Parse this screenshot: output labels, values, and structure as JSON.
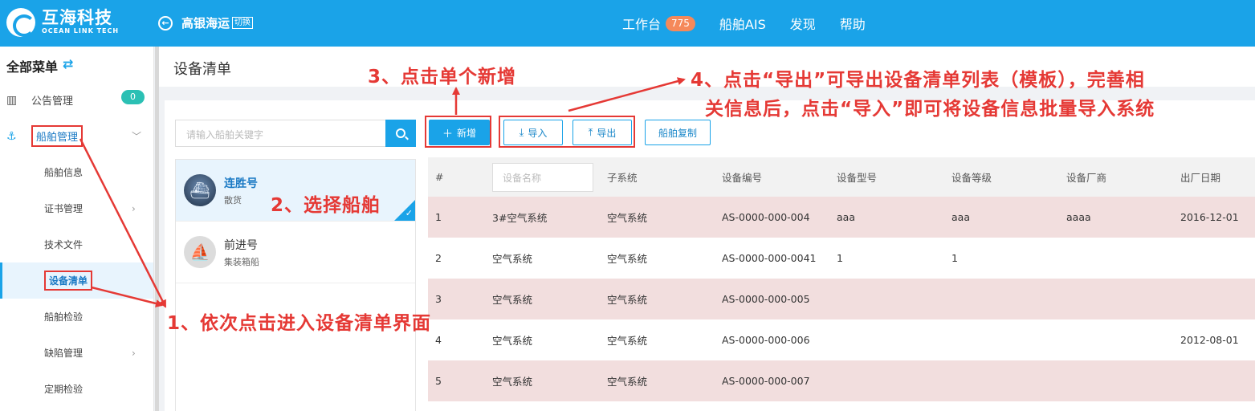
{
  "brand": {
    "name_cn": "互海科技",
    "name_en": "OCEAN LINK TECH"
  },
  "company": {
    "name": "高银海运",
    "switch_label": "切换"
  },
  "topnav": [
    {
      "label": "工作台",
      "badge": "775"
    },
    {
      "label": "船舶AIS"
    },
    {
      "label": "发现"
    },
    {
      "label": "帮助"
    }
  ],
  "sidebar": {
    "header": "全部菜单",
    "items": [
      {
        "label": "公告管理",
        "badge": "0"
      },
      {
        "label": "船舶管理"
      }
    ],
    "submenu": [
      "船舶信息",
      "证书管理",
      "技术文件",
      "设备清单",
      "船舶检验",
      "缺陷管理",
      "定期检验"
    ]
  },
  "page": {
    "title": "设备清单"
  },
  "search": {
    "placeholder": "请输入船舶关键字"
  },
  "ships": [
    {
      "name": "连胜号",
      "type": "散货"
    },
    {
      "name": "前进号",
      "type": "集装箱船"
    }
  ],
  "toolbar": {
    "add": "新增",
    "import": "导入",
    "export": "导出",
    "copy": "船舶复制"
  },
  "table": {
    "columns": [
      "#",
      "设备名称",
      "子系统",
      "设备编号",
      "设备型号",
      "设备等级",
      "设备厂商",
      "出厂日期"
    ],
    "filter_placeholder": "设备名称",
    "rows": [
      [
        "1",
        "3#空气系统",
        "空气系统",
        "AS-0000-000-004",
        "aaa",
        "aaa",
        "aaaa",
        "2016-12-01"
      ],
      [
        "2",
        "空气系统",
        "空气系统",
        "AS-0000-000-0041",
        "1",
        "1",
        "",
        ""
      ],
      [
        "3",
        "空气系统",
        "空气系统",
        "AS-0000-000-005",
        "",
        "",
        "",
        ""
      ],
      [
        "4",
        "空气系统",
        "空气系统",
        "AS-0000-000-006",
        "",
        "",
        "",
        "2012-08-01"
      ],
      [
        "5",
        "空气系统",
        "空气系统",
        "AS-0000-000-007",
        "",
        "",
        "",
        ""
      ]
    ]
  },
  "annotations": {
    "step1": "1、依次点击进入设备清单界面",
    "step2": "2、选择船舶",
    "step3": "3、点击单个新增",
    "step4_line1": "4、点击“导出”可导出设备清单列表（模板），完善相",
    "step4_line2": "关信息后，点击“导入”即可将设备信息批量导入系统"
  },
  "colors": {
    "primary": "#1aa3e8",
    "annotation": "#e53935",
    "row_highlight": "#f2dede"
  }
}
